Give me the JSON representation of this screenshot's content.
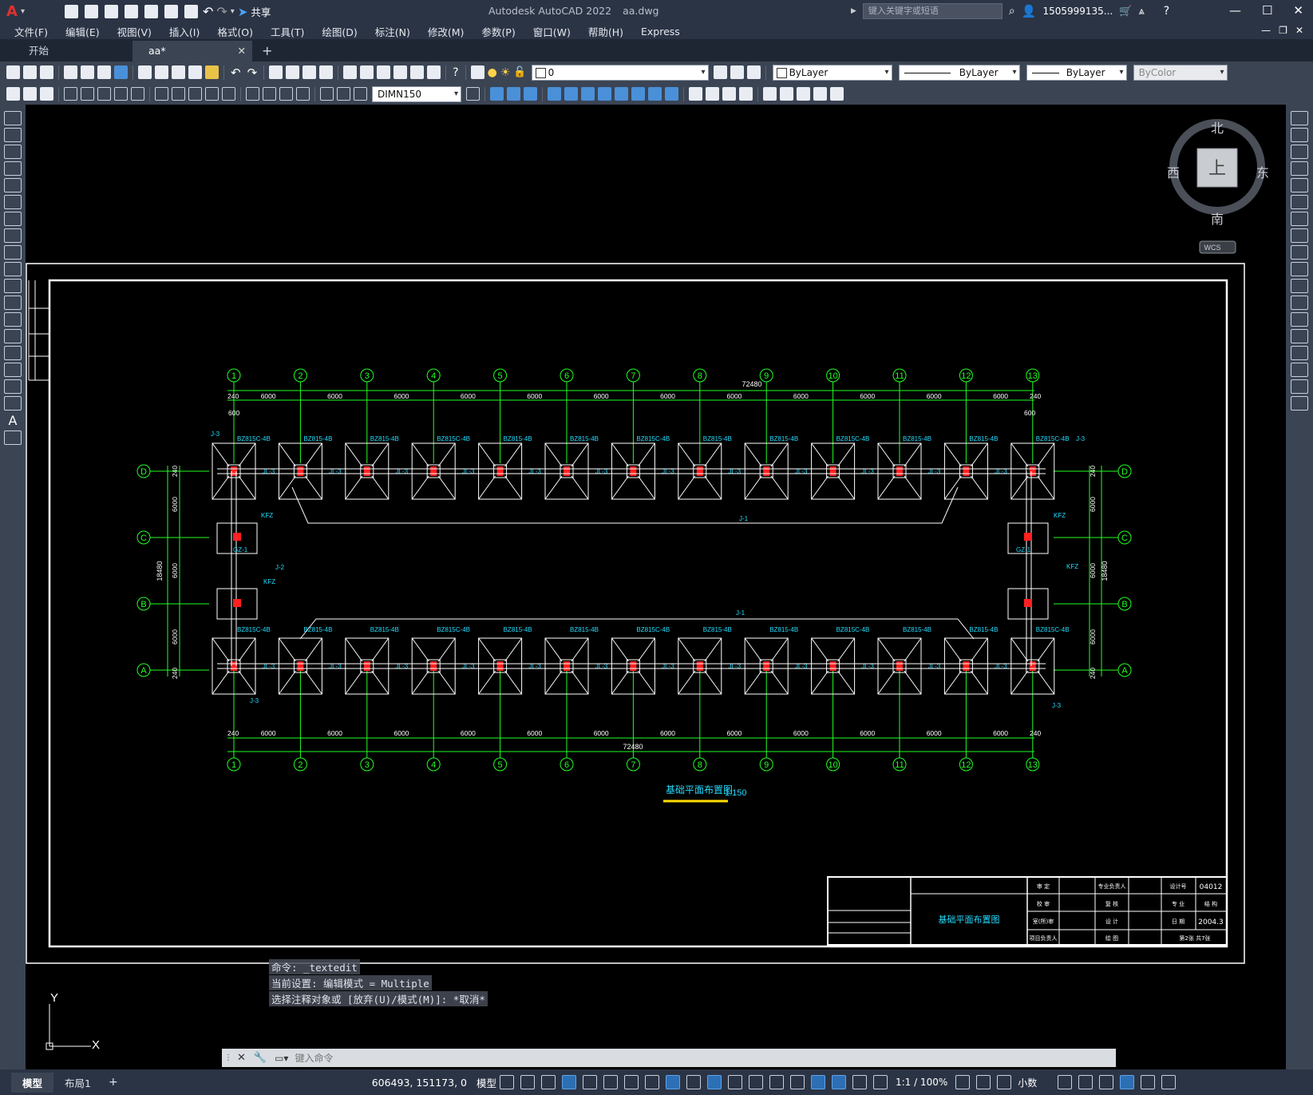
{
  "titlebar": {
    "share_label": "共享",
    "app_title": "Autodesk AutoCAD 2022",
    "doc_name": "aa.dwg",
    "search_placeholder": "键入关键字或短语",
    "user": "1505999135..."
  },
  "menu": [
    "文件(F)",
    "编辑(E)",
    "视图(V)",
    "插入(I)",
    "格式(O)",
    "工具(T)",
    "绘图(D)",
    "标注(N)",
    "修改(M)",
    "参数(P)",
    "窗口(W)",
    "帮助(H)",
    "Express"
  ],
  "tabs": [
    {
      "label": "开始"
    },
    {
      "label": "aa*"
    }
  ],
  "toolbar": {
    "layer": "0",
    "color": "ByLayer",
    "linetype": "ByLayer",
    "lineweight": "ByLayer",
    "plotstyle": "ByColor",
    "dimstyle": "DIMN150"
  },
  "viewcube": {
    "north": "北",
    "south": "南",
    "east": "东",
    "west": "西",
    "top": "上",
    "wcs": "WCS"
  },
  "drawing": {
    "axes_num": [
      "1",
      "2",
      "3",
      "4",
      "5",
      "6",
      "7",
      "8",
      "9",
      "10",
      "11",
      "12",
      "13"
    ],
    "axes_letter": [
      "D",
      "C",
      "B",
      "A"
    ],
    "span_dim": "6000",
    "edge_dim": "240",
    "total_dim": "72480",
    "side_dim": "18480",
    "small_dim": "600",
    "footing_label": "BZ815C-4B",
    "footing_label_alt": "BZ815-4B",
    "beam_label": "JL-3",
    "beam_j1": "J-1",
    "beam_j2": "J-2",
    "beam_j3": "J-3",
    "kfz": "KFZ",
    "gz": "GZ-1",
    "plan_title": "基础平面布置图",
    "plan_scale": "1:150"
  },
  "title_block": {
    "name": "基础平面布置图",
    "cells": [
      "审 定",
      "专业负责人",
      "设计号",
      "04012",
      "校 审",
      "复 核",
      "专 业",
      "结 构",
      "室(所)审",
      "设 计",
      "日 期",
      "2004.3",
      "项目负责人",
      "绘 图",
      "第2张 共7张"
    ]
  },
  "command": {
    "history": [
      "命令: _textedit",
      "当前设置: 编辑模式 = Multiple",
      "选择注释对象或 [放弃(U)/模式(M)]: *取消*"
    ],
    "placeholder": "键入命令"
  },
  "ucs": {
    "x": "X",
    "y": "Y"
  },
  "status": {
    "tab_model": "模型",
    "tab_layout": "布局1",
    "coords": "606493, 151173, 0",
    "model": "模型",
    "scale": "1:1 / 100%",
    "units": "小数"
  },
  "colors": {
    "green": "#22ff22",
    "cyan": "#22ddff",
    "white": "#ffffff",
    "red": "#ff2020",
    "yellow": "#ffdd00",
    "chrome": "#2b3445"
  }
}
